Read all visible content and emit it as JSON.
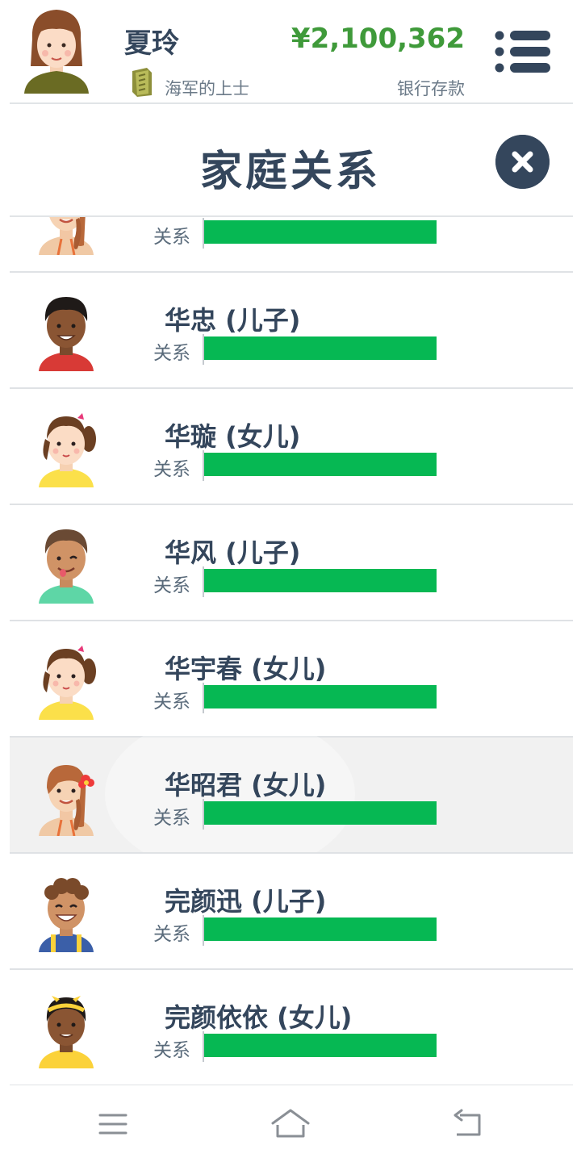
{
  "header": {
    "player_name": "夏玲",
    "rank": "海军的上士",
    "money": "¥2,100,362",
    "bank_label": "银行存款"
  },
  "title": "家庭关系",
  "relationship_label": "关系",
  "members": [
    {
      "name": "",
      "relationship_level": 1.0,
      "avatar": "girl-orange-hair-avatar"
    },
    {
      "name": "华忠 (儿子)",
      "relationship_level": 1.0,
      "avatar": "boy-dark-skin-avatar"
    },
    {
      "name": "华璇 (女儿)",
      "relationship_level": 1.0,
      "avatar": "girl-pigtails-avatar"
    },
    {
      "name": "华风 (儿子)",
      "relationship_level": 1.0,
      "avatar": "boy-winking-avatar"
    },
    {
      "name": "华宇春 (女儿)",
      "relationship_level": 1.0,
      "avatar": "girl-pigtails-avatar"
    },
    {
      "name": "华昭君 (女儿)",
      "relationship_level": 1.0,
      "avatar": "girl-flower-avatar"
    },
    {
      "name": "完颜迅 (儿子)",
      "relationship_level": 1.0,
      "avatar": "boy-curly-hair-avatar"
    },
    {
      "name": "完颜依依 (女儿)",
      "relationship_level": 1.0,
      "avatar": "girl-headband-avatar"
    }
  ],
  "colors": {
    "primary": "#34465c",
    "money": "#3f9a3a",
    "bar": "#06b853",
    "highlight_row": "#f1f1f1"
  },
  "nav": {
    "menu_icon": "menu-lines-icon",
    "home_icon": "home-icon",
    "back_icon": "back-icon"
  }
}
